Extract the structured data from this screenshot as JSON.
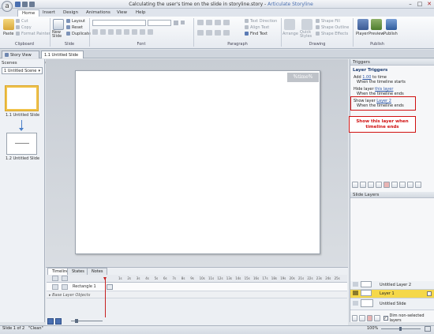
{
  "window": {
    "title": "Calculating the user's time on the slide in storyline.story",
    "app_name": "Articulate Storyline",
    "separator": " - "
  },
  "ribbon": {
    "tabs": [
      "Home",
      "Insert",
      "Design",
      "Animations",
      "View",
      "Help"
    ],
    "active_tab": "Home",
    "clipboard": {
      "paste": "Paste",
      "cut": "Cut",
      "copy": "Copy",
      "format_painter": "Format Painter",
      "label": "Clipboard"
    },
    "slide": {
      "new_slide": "New Slide",
      "layout": "Layout",
      "reset": "Reset",
      "duplicate": "Duplicate",
      "label": "Slide"
    },
    "font": {
      "label": "Font"
    },
    "paragraph": {
      "text_direction": "Text Direction",
      "align_text": "Align Text",
      "find_text": "Find Text",
      "label": "Paragraph"
    },
    "drawing": {
      "arrange": "Arrange",
      "quick_styles": "Quick Styles",
      "shape_fill": "Shape Fill",
      "shape_outline": "Shape Outline",
      "shape_effects": "Shape Effects",
      "label": "Drawing"
    },
    "publish": {
      "player": "Player",
      "preview": "Preview",
      "publish": "Publish",
      "label": "Publish"
    }
  },
  "doc_tabs": [
    "Story View",
    "1.1 Untitled Slide"
  ],
  "scenes": {
    "header": "Scenes",
    "selected": "1 Untitled Scene",
    "slides": [
      "1.1 Untitled Slide",
      "1.2 Untitled Slide"
    ]
  },
  "canvas": {
    "badge_text": "%time%"
  },
  "timeline": {
    "tabs": [
      "Timeline",
      "States",
      "Notes"
    ],
    "active_tab": "Timeline",
    "rows": [
      "Rectangle 1",
      "Base Layer Objects"
    ],
    "ticks": [
      "1s",
      "2s",
      "3s",
      "4s",
      "5s",
      "6s",
      "7s",
      "8s",
      "9s",
      "10s",
      "11s",
      "12s",
      "13s",
      "14s",
      "15s",
      "16s",
      "17s",
      "18s",
      "19s",
      "20s",
      "21s",
      "22s",
      "23s",
      "24s",
      "25s"
    ]
  },
  "triggers": {
    "header": "Triggers",
    "section": "Layer Triggers",
    "items": [
      {
        "pre": "Add ",
        "link": "1.00",
        "post": " to time",
        "sub": "When the timeline starts"
      },
      {
        "pre": "Hide layer ",
        "link": "this layer",
        "post": "",
        "sub": "When the timeline ends"
      },
      {
        "pre": "Show layer ",
        "link": "Layer 2",
        "post": "",
        "sub": "When the timeline ends"
      }
    ],
    "callout": "Show this layer when timeline ends"
  },
  "slide_layers": {
    "header": "Slide Layers",
    "layers": [
      {
        "name": "Untitled Layer 2",
        "selected": false
      },
      {
        "name": "Layer 1",
        "selected": true
      },
      {
        "name": "Untitled Slide",
        "selected": false
      }
    ],
    "dim_label": "Dim non-selected layers"
  },
  "status": {
    "slide_info": "Slide 1 of 2",
    "theme": "\"Clean\"",
    "zoom": "100%"
  },
  "colors": {
    "accent_blue": "#4a6fb0",
    "callout_red": "#d01010",
    "selected_layer": "#f5d84a",
    "playhead_red": "#c62020"
  }
}
